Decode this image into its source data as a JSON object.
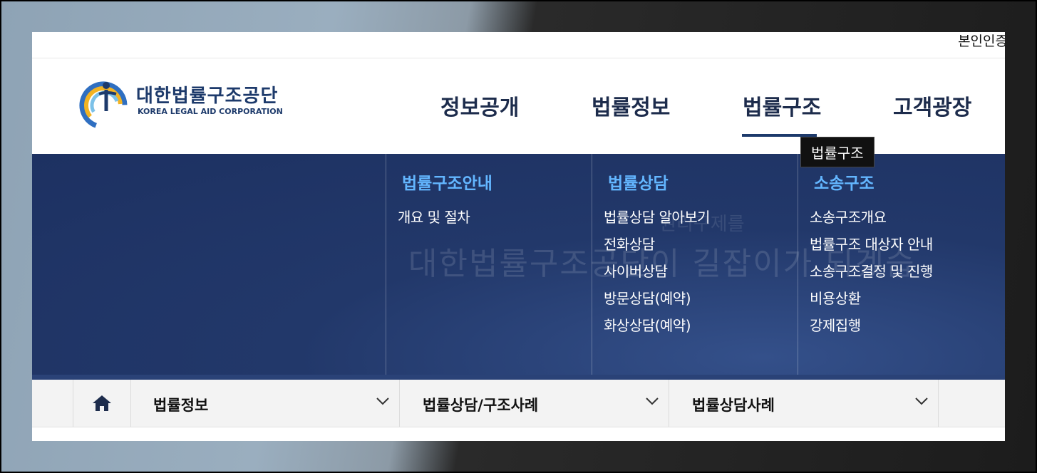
{
  "utility": {
    "auth_link": "본인인증"
  },
  "logo": {
    "name_ko": "대한법률구조공단",
    "name_en": "KOREA LEGAL AID CORPORATION"
  },
  "gnb": {
    "items": [
      {
        "label": "정보공개"
      },
      {
        "label": "법률정보"
      },
      {
        "label": "법률구조",
        "active": true
      },
      {
        "label": "고객광장"
      }
    ],
    "tooltip": "법률구조"
  },
  "mega_menu": {
    "background_text": "대한법률구조공단이 길잡이가 되겠습",
    "background_subtext": "권리구제를",
    "columns": [
      {
        "title": "법률구조안내",
        "items": [
          "개요 및 절차"
        ]
      },
      {
        "title": "법률상담",
        "items": [
          "법률상담 알아보기",
          "전화상담",
          "사이버상담",
          "방문상담(예약)",
          "화상상담(예약)"
        ]
      },
      {
        "title": "소송구조",
        "items": [
          "소송구조개요",
          "법률구조 대상자 안내",
          "소송구조결정 및 진행",
          "비용상환",
          "강제집행"
        ]
      }
    ]
  },
  "location": {
    "home_icon": "home-icon",
    "crumbs": [
      {
        "label": "법률정보"
      },
      {
        "label": "법률상담/구조사례"
      },
      {
        "label": "법률상담사례"
      }
    ]
  },
  "colors": {
    "brand_navy": "#1d3a6b",
    "mega_bg": "#22386a",
    "mega_title": "#63b6ff",
    "tooltip_bg": "#111111"
  }
}
